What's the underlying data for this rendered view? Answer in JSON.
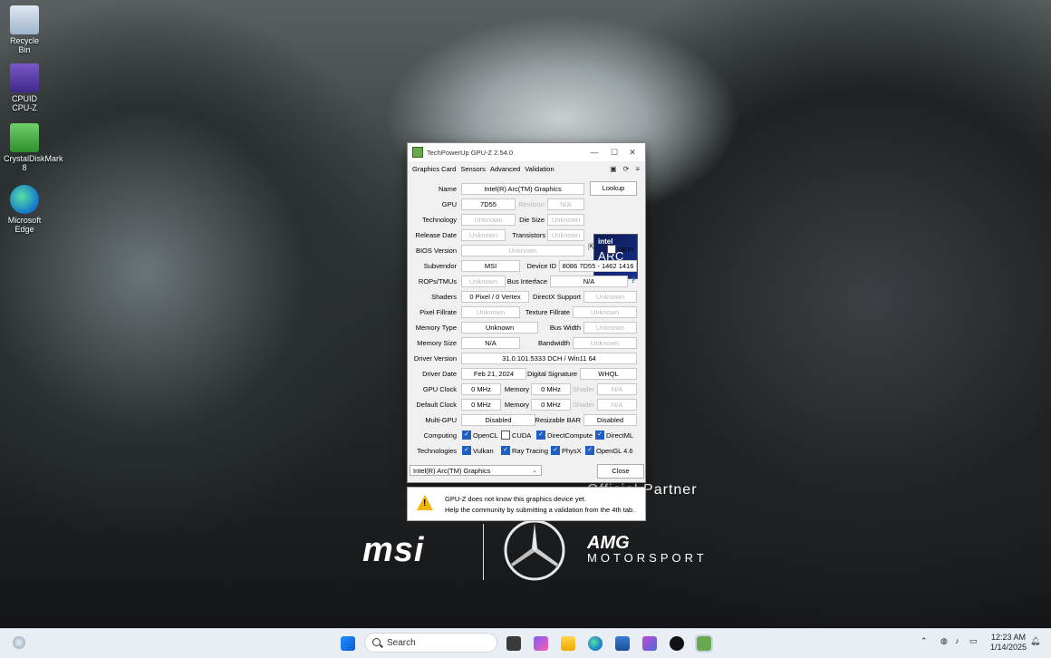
{
  "desktop": {
    "icons": [
      {
        "label": "Recycle Bin",
        "icon": "recycle-bin-icon"
      },
      {
        "label": "CPUID CPU-Z",
        "icon": "cpuz-icon"
      },
      {
        "label": "CrystalDiskMark 8",
        "icon": "crystaldiskmark-icon"
      },
      {
        "label": "Microsoft Edge",
        "icon": "edge-icon"
      }
    ],
    "wallpaper": {
      "partner": "Official Partner",
      "msi": "msi",
      "amg": "AMG",
      "motorsport": "MOTORSPORT"
    }
  },
  "gpuz": {
    "title": "TechPowerUp GPU-Z 2.54.0",
    "tabs": [
      "Graphics Card",
      "Sensors",
      "Advanced",
      "Validation"
    ],
    "toolbar_icons": [
      "camera-icon",
      "refresh-icon",
      "menu-icon"
    ],
    "labels": {
      "name": "Name",
      "gpu": "GPU",
      "revision": "Revision",
      "technology": "Technology",
      "die_size": "Die Size",
      "release_date": "Release Date",
      "transistors": "Transistors",
      "bios_version": "BIOS Version",
      "uefi": "UEFI",
      "subvendor": "Subvendor",
      "device_id": "Device ID",
      "rops_tmus": "ROPs/TMUs",
      "bus_interface": "Bus Interface",
      "shaders": "Shaders",
      "directx_support": "DirectX Support",
      "pixel_fillrate": "Pixel Fillrate",
      "texture_fillrate": "Texture Fillrate",
      "memory_type": "Memory Type",
      "bus_width": "Bus Width",
      "memory_size": "Memory Size",
      "bandwidth": "Bandwidth",
      "driver_version": "Driver Version",
      "driver_date": "Driver Date",
      "digital_signature": "Digital Signature",
      "gpu_clock": "GPU Clock",
      "memory": "Memory",
      "shader": "Shader",
      "default_clock": "Default Clock",
      "multi_gpu": "Multi-GPU",
      "resizable_bar": "Resizable BAR",
      "computing": "Computing",
      "technologies": "Technologies"
    },
    "values": {
      "name": "Intel(R) Arc(TM) Graphics",
      "gpu": "7D55",
      "revision": "N/A",
      "technology": "Unknown",
      "die_size": "Unknown",
      "release_date": "Unknown",
      "transistors": "Unknown",
      "bios_version": "Unknown",
      "subvendor": "MSI",
      "device_id": "8086 7D55 - 1462 1416",
      "rops_tmus": "Unknown",
      "bus_interface": "N/A",
      "shaders": "0 Pixel / 0 Vertex",
      "directx_support": "Unknown",
      "pixel_fillrate": "Unknown",
      "texture_fillrate": "Unknown",
      "memory_type": "Unknown",
      "bus_width": "Unknown",
      "memory_size": "N/A",
      "bandwidth": "Unknown",
      "driver_version": "31.0.101.5333 DCH / Win11 64",
      "driver_date": "Feb 21, 2024",
      "digital_signature": "WHQL",
      "gpu_clock": "0 MHz",
      "gpu_clock_memory": "0 MHz",
      "gpu_clock_shader": "N/A",
      "default_clock": "0 MHz",
      "default_clock_memory": "0 MHz",
      "default_clock_shader": "N/A",
      "multi_gpu": "Disabled",
      "resizable_bar": "Disabled"
    },
    "computing": [
      {
        "label": "OpenCL",
        "checked": true
      },
      {
        "label": "CUDA",
        "checked": false
      },
      {
        "label": "DirectCompute",
        "checked": true
      },
      {
        "label": "DirectML",
        "checked": true
      }
    ],
    "technologies": [
      {
        "label": "Vulkan",
        "checked": true
      },
      {
        "label": "Ray Tracing",
        "checked": true
      },
      {
        "label": "PhysX",
        "checked": true
      },
      {
        "label": "OpenGL 4.6",
        "checked": true
      }
    ],
    "lookup_label": "Lookup",
    "help_label": "?",
    "logo": {
      "brand": "intel",
      "product": "ARC",
      "sub": "GRAPHICS"
    },
    "device_select": "Intel(R) Arc(TM) Graphics",
    "close_label": "Close",
    "notice": {
      "line1": "GPU-Z does not know this graphics device yet.",
      "line2": "Help the community by submitting a validation from the 4th tab."
    }
  },
  "taskbar": {
    "search_placeholder": "Search",
    "time": "12:23 AM",
    "date": "1/14/2025",
    "apps": [
      "start-icon",
      "task-view-icon",
      "copilot-icon",
      "file-explorer-icon",
      "edge-icon",
      "store-icon",
      "photos-icon",
      "xbox-icon",
      "gpuz-icon"
    ]
  }
}
